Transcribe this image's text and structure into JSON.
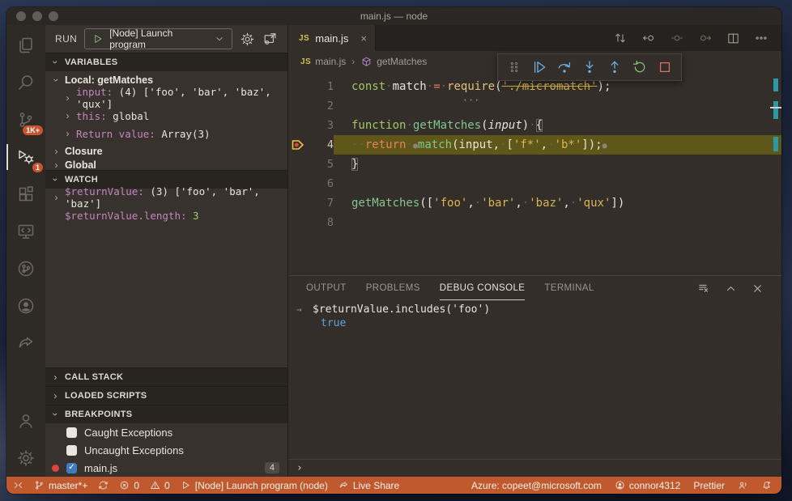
{
  "window": {
    "title": "main.js — node"
  },
  "colors": {
    "status_bar": "#c1592f",
    "badge": "#ca5430",
    "debug_line_highlight": "#5e5719",
    "accent_blue": "#6cb2e8",
    "accent_green": "#8ac77a",
    "accent_red": "#df6f5e",
    "variable_name": "#c585bf",
    "string": "#d9b54e",
    "result_true": "#5ea2d8"
  },
  "activity_bar": {
    "top_items": [
      {
        "id": "explorer",
        "icon": "files-icon",
        "badge": null,
        "active": false
      },
      {
        "id": "search",
        "icon": "search-icon",
        "badge": null,
        "active": false
      },
      {
        "id": "source-control",
        "icon": "source-control-icon",
        "badge": "1K+",
        "active": false
      },
      {
        "id": "run-debug",
        "icon": "debug-icon",
        "badge": "1",
        "active": true
      },
      {
        "id": "extensions",
        "icon": "extensions-icon",
        "badge": null,
        "active": false
      },
      {
        "id": "remote-explorer",
        "icon": "remote-explorer-icon",
        "badge": null,
        "active": false
      },
      {
        "id": "pull-requests",
        "icon": "circle-branch-icon",
        "badge": null,
        "active": false
      },
      {
        "id": "github",
        "icon": "github-icon",
        "badge": null,
        "active": false
      },
      {
        "id": "live-share",
        "icon": "live-share-icon",
        "badge": null,
        "active": false
      }
    ],
    "bottom_items": [
      {
        "id": "account",
        "icon": "account-icon",
        "badge": null,
        "active": false
      },
      {
        "id": "settings",
        "icon": "gear-icon",
        "badge": null,
        "active": false
      }
    ]
  },
  "sidebar": {
    "run_bar": {
      "label": "RUN",
      "config": "[Node] Launch program"
    },
    "variables": {
      "title": "VARIABLES",
      "rows": [
        {
          "kind": "scope",
          "indent": 1,
          "expanded": true,
          "label": "Local: getMatches"
        },
        {
          "kind": "var",
          "indent": 2,
          "expandable": true,
          "name": "input:",
          "value": " (4) ['foo', 'bar', 'baz', 'qux']"
        },
        {
          "kind": "var",
          "indent": 2,
          "expandable": true,
          "name": "this:",
          "value": " global"
        },
        {
          "kind": "var",
          "indent": 2,
          "expandable": true,
          "name": "Return value:",
          "value": " Array(3)"
        },
        {
          "kind": "scope",
          "indent": 1,
          "expanded": false,
          "label": "Closure"
        },
        {
          "kind": "scope",
          "indent": 1,
          "expanded": false,
          "label": "Global",
          "clipped": true
        }
      ]
    },
    "watch": {
      "title": "WATCH",
      "rows": [
        {
          "kind": "var",
          "indent": 1,
          "expandable": true,
          "name": "$returnValue:",
          "value": " (3) ['foo', 'bar', 'baz']"
        },
        {
          "kind": "var",
          "indent": 1,
          "expandable": false,
          "name": "$returnValue.length:",
          "value": " 3",
          "value_class": "num"
        }
      ]
    },
    "call_stack": {
      "title": "CALL STACK",
      "expanded": false
    },
    "loaded_scripts": {
      "title": "LOADED SCRIPTS",
      "expanded": false
    },
    "breakpoints": {
      "title": "BREAKPOINTS",
      "expanded": true,
      "rows": [
        {
          "checked": false,
          "label": "Caught Exceptions",
          "dot": false,
          "badge": null
        },
        {
          "checked": false,
          "label": "Uncaught Exceptions",
          "dot": false,
          "badge": null
        },
        {
          "checked": true,
          "label": "main.js",
          "dot": true,
          "badge": "4"
        }
      ]
    }
  },
  "editor": {
    "tab": {
      "icon": "JS",
      "label": "main.js",
      "close": "×"
    },
    "breadcrumb": [
      {
        "icon": "JS",
        "label": "main.js"
      },
      {
        "icon": "method",
        "label": "getMatches"
      }
    ],
    "current_line": 4,
    "lines": [
      {
        "n": 1,
        "tokens": [
          {
            "t": "const",
            "c": "kw"
          },
          {
            "t": "·",
            "c": "ws"
          },
          {
            "t": "match",
            "c": "fg"
          },
          {
            "t": "·",
            "c": "ws"
          },
          {
            "t": "=",
            "c": "op"
          },
          {
            "t": "·",
            "c": "ws"
          },
          {
            "t": "require",
            "c": "fnY hint"
          },
          {
            "t": "(",
            "c": "fg"
          },
          {
            "t": "'./micromatch'",
            "c": "str strike"
          },
          {
            "t": ");",
            "c": "fg"
          }
        ]
      },
      {
        "n": 2,
        "tokens": []
      },
      {
        "n": 3,
        "tokens": [
          {
            "t": "function",
            "c": "kw"
          },
          {
            "t": "·",
            "c": "ws"
          },
          {
            "t": "getMatches",
            "c": "fnG"
          },
          {
            "t": "(",
            "c": "fg"
          },
          {
            "t": "input",
            "c": "param"
          },
          {
            "t": ")",
            "c": "fg"
          },
          {
            "t": "·",
            "c": "ws"
          },
          {
            "t": "{",
            "c": "fg brkt"
          }
        ]
      },
      {
        "n": 4,
        "tokens": [
          {
            "t": "··",
            "c": "ws"
          },
          {
            "t": "return",
            "c": "ret"
          },
          {
            "t": "·",
            "c": "ws"
          },
          {
            "t": "●",
            "c": "bpdot"
          },
          {
            "t": "match",
            "c": "fnG"
          },
          {
            "t": "(input,",
            "c": "fg"
          },
          {
            "t": "·",
            "c": "ws"
          },
          {
            "t": "[",
            "c": "fg"
          },
          {
            "t": "'f*'",
            "c": "str"
          },
          {
            "t": ",",
            "c": "fg"
          },
          {
            "t": "·",
            "c": "ws"
          },
          {
            "t": "'b*'",
            "c": "str"
          },
          {
            "t": "]);",
            "c": "fg"
          },
          {
            "t": "●",
            "c": "bpdot"
          }
        ]
      },
      {
        "n": 5,
        "tokens": [
          {
            "t": "}",
            "c": "fg brkt"
          }
        ]
      },
      {
        "n": 6,
        "tokens": []
      },
      {
        "n": 7,
        "tokens": [
          {
            "t": "getMatches",
            "c": "fnG"
          },
          {
            "t": "([",
            "c": "fg"
          },
          {
            "t": "'foo'",
            "c": "str"
          },
          {
            "t": ",",
            "c": "fg"
          },
          {
            "t": "·",
            "c": "ws"
          },
          {
            "t": "'bar'",
            "c": "str"
          },
          {
            "t": ",",
            "c": "fg"
          },
          {
            "t": "·",
            "c": "ws"
          },
          {
            "t": "'baz'",
            "c": "str"
          },
          {
            "t": ",",
            "c": "fg"
          },
          {
            "t": "·",
            "c": "ws"
          },
          {
            "t": "'qux'",
            "c": "str"
          },
          {
            "t": "])",
            "c": "fg"
          }
        ]
      },
      {
        "n": 8,
        "tokens": []
      }
    ]
  },
  "debug_toolbar": {
    "buttons": [
      {
        "id": "continue",
        "icon": "continue-icon",
        "color": "c-blue"
      },
      {
        "id": "step-over",
        "icon": "step-over-icon",
        "color": "c-blue"
      },
      {
        "id": "step-into",
        "icon": "step-into-icon",
        "color": "c-blue"
      },
      {
        "id": "step-out",
        "icon": "step-out-icon",
        "color": "c-blue"
      },
      {
        "id": "restart",
        "icon": "restart-icon",
        "color": "c-green"
      },
      {
        "id": "stop",
        "icon": "stop-icon",
        "color": "c-red"
      }
    ]
  },
  "panel": {
    "tabs": [
      {
        "label": "OUTPUT",
        "active": false
      },
      {
        "label": "PROBLEMS",
        "active": false
      },
      {
        "label": "DEBUG CONSOLE",
        "active": true
      },
      {
        "label": "TERMINAL",
        "active": false
      }
    ],
    "console": {
      "expression": "$returnValue.includes('foo')",
      "result": "true",
      "prompt": "›"
    }
  },
  "status_bar": {
    "left": [
      {
        "id": "remote",
        "icon": "remote-icon",
        "text": ""
      },
      {
        "id": "branch",
        "icon": "branch-icon",
        "text": "master*+"
      },
      {
        "id": "sync",
        "icon": "sync-icon",
        "text": ""
      },
      {
        "id": "errors",
        "icon": "error-icon",
        "text": "0"
      },
      {
        "id": "warnings",
        "icon": "warning-icon",
        "text": "0"
      },
      {
        "id": "debug-config",
        "icon": "play-outline-icon",
        "text": "[Node] Launch program (node)"
      },
      {
        "id": "live-share",
        "icon": "live-share-icon",
        "text": "Live Share"
      }
    ],
    "right": [
      {
        "id": "azure-account",
        "icon": null,
        "text": "Azure: copeet@microsoft.com"
      },
      {
        "id": "github-account",
        "icon": "github-icon",
        "text": "connor4312"
      },
      {
        "id": "prettier",
        "icon": null,
        "text": "Prettier"
      },
      {
        "id": "feedback",
        "icon": "feedback-icon",
        "text": ""
      },
      {
        "id": "notifications",
        "icon": "bell-icon",
        "text": ""
      }
    ]
  }
}
